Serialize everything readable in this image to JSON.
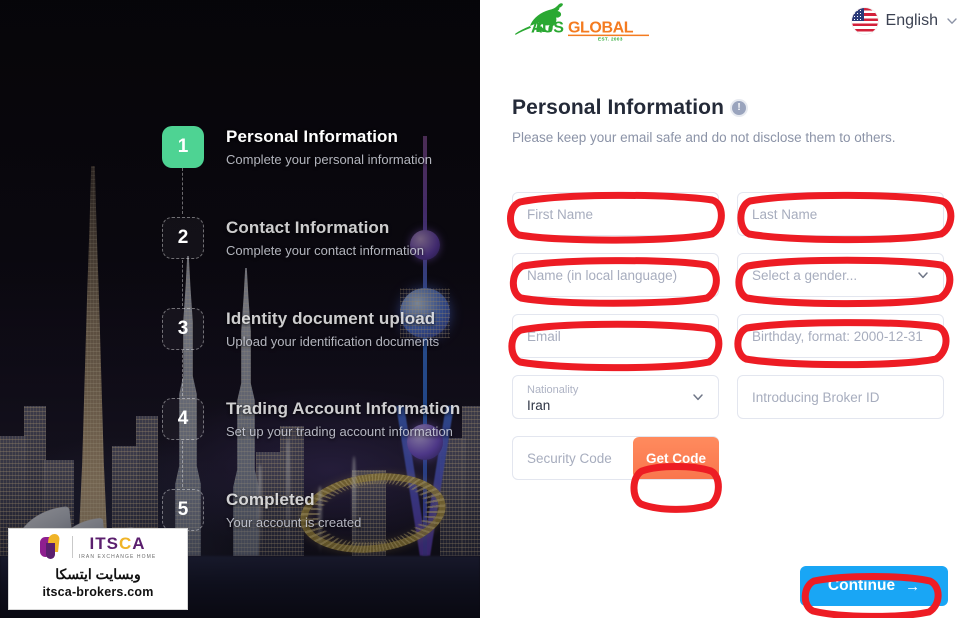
{
  "brand": {
    "logo_alt": "AUS GLOBAL",
    "logo_word_1": "AUS",
    "logo_word_2": "GLOBAL",
    "logo_est": "EST. 2003",
    "green": "#2aa832",
    "orange": "#f47b20"
  },
  "topbar": {
    "language_label": "English",
    "flag_icon": "us-flag-icon",
    "chevron_icon": "chevron-down-icon"
  },
  "header": {
    "title": "Personal Information",
    "info_icon": "info-icon",
    "info_glyph": "!",
    "subtitle": "Please keep your email safe and do not disclose them to others."
  },
  "stepper": {
    "steps": [
      {
        "number": "1",
        "title": "Personal Information",
        "subtitle": "Complete your personal information",
        "state": "active"
      },
      {
        "number": "2",
        "title": "Contact Information",
        "subtitle": "Complete your contact information",
        "state": "idle"
      },
      {
        "number": "3",
        "title": "Identity document upload",
        "subtitle": "Upload your identification documents",
        "state": "idle"
      },
      {
        "number": "4",
        "title": "Trading Account Information",
        "subtitle": "Set up your trading account information",
        "state": "idle"
      },
      {
        "number": "5",
        "title": "Completed",
        "subtitle": "Your account is created",
        "state": "idle"
      }
    ],
    "active_color": "#4ed393"
  },
  "form": {
    "first_name": {
      "label": "First Name",
      "placeholder": "First Name",
      "value": ""
    },
    "last_name": {
      "label": "Last Name",
      "placeholder": "Last Name",
      "value": ""
    },
    "local_name": {
      "label": "Name (in local language)",
      "placeholder": "Name (in local language)",
      "value": ""
    },
    "gender": {
      "placeholder": "Select a gender...",
      "value": "",
      "chevron_icon": "chevron-down-icon"
    },
    "email": {
      "label": "Email",
      "placeholder": "Email",
      "value": ""
    },
    "birthday": {
      "label": "Birthday, format: 2000-12-31",
      "placeholder": "Birthday, format: 2000-12-31",
      "value": ""
    },
    "nationality": {
      "float_label": "Nationality",
      "value": "Iran",
      "chevron_icon": "chevron-down-icon"
    },
    "broker_id": {
      "label": "Introducing Broker ID",
      "placeholder": "Introducing Broker ID",
      "value": ""
    },
    "security_code": {
      "label": "Security Code",
      "placeholder": "Security Code",
      "value": ""
    },
    "get_code_button": "Get Code",
    "continue_button": "Continue",
    "continue_arrow": "→",
    "accent_orange": "#f9764d",
    "accent_blue": "#19a6f5"
  },
  "annotations": {
    "color": "#ed1c24",
    "targets": [
      "first-name-field",
      "last-name-field",
      "local-name-field",
      "gender-field",
      "email-field",
      "birthday-field",
      "get-code-button",
      "continue-button"
    ]
  },
  "watermark": {
    "name_part_1": "ITS",
    "name_part_2": "C",
    "name_part_3": "A",
    "tagline": "IRAN EXCHANGE HOME",
    "persian": "وبسایت ایتسکا",
    "url": "itsca-brokers.com"
  }
}
